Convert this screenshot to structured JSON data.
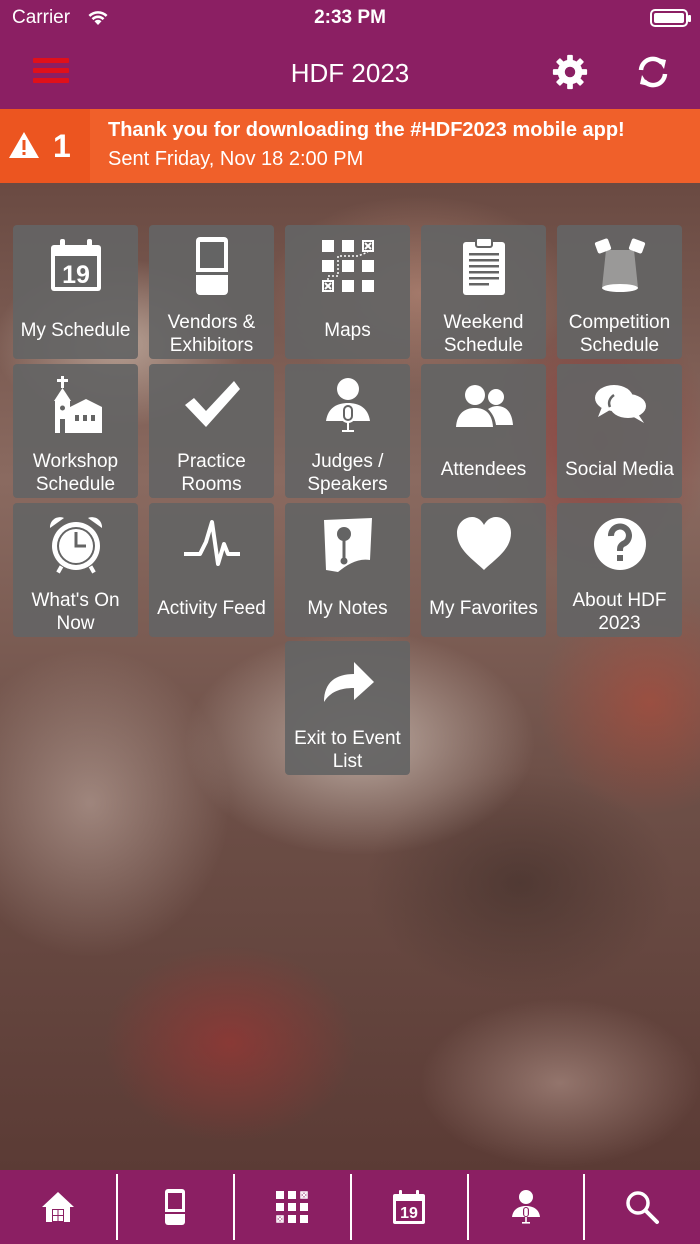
{
  "status_bar": {
    "carrier": "Carrier",
    "time": "2:33 PM"
  },
  "header": {
    "title": "HDF 2023"
  },
  "banner": {
    "count": "1",
    "message": "Thank you for downloading the #HDF2023 mobile app!",
    "sent": "Sent Friday, Nov 18 2:00 PM"
  },
  "tiles": [
    {
      "label": "My Schedule",
      "icon": "calendar-icon"
    },
    {
      "label": "Vendors & Exhibitors",
      "icon": "booth-icon"
    },
    {
      "label": "Maps",
      "icon": "map-grid-icon"
    },
    {
      "label": "Weekend Schedule",
      "icon": "clipboard-icon"
    },
    {
      "label": "Competition Schedule",
      "icon": "spotlight-icon"
    },
    {
      "label": "Workshop Schedule",
      "icon": "church-icon"
    },
    {
      "label": "Practice Rooms",
      "icon": "checkmark-icon"
    },
    {
      "label": "Judges / Speakers",
      "icon": "speaker-icon"
    },
    {
      "label": "Attendees",
      "icon": "people-icon"
    },
    {
      "label": "Social Media",
      "icon": "chat-bubbles-icon"
    },
    {
      "label": "What's On Now",
      "icon": "alarm-clock-icon"
    },
    {
      "label": "Activity Feed",
      "icon": "pulse-icon"
    },
    {
      "label": "My Notes",
      "icon": "note-icon"
    },
    {
      "label": "My Favorites",
      "icon": "heart-icon"
    },
    {
      "label": "About HDF 2023",
      "icon": "question-icon"
    },
    {
      "label": "Exit to Event List",
      "icon": "share-arrow-icon"
    }
  ],
  "calendar_day": "19",
  "tab_bar": [
    "home-icon",
    "booth-icon",
    "map-grid-icon",
    "calendar-icon",
    "speaker-icon",
    "search-icon"
  ],
  "colors": {
    "brand": "#8b1f63",
    "banner": "#f0602a",
    "tile": "#646464"
  }
}
